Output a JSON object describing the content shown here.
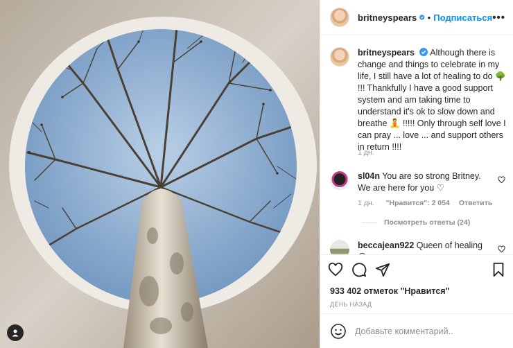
{
  "colors": {
    "accent": "#0095f6",
    "text": "#262626",
    "muted": "#8e8e8e",
    "divider": "#efefef"
  },
  "header": {
    "username": "britneyspears",
    "separator": "•",
    "follow_label": "Подписаться",
    "more_icon": "more-options-icon",
    "more_label": "•••"
  },
  "caption": {
    "username": "britneyspears",
    "text_part1": "Although there is change and things to celebrate in my life, I still have a lot of healing to do ",
    "emoji1": "🌳",
    "text_part2": " !!! Thankfully I have a good support system and am taking time to understand it's ok to slow down and breathe ",
    "emoji2": "🧘",
    "text_part3": " !!!!! Only through self love I can pray ... love ... and support others in return !!!!",
    "time": "1 дн."
  },
  "comments": [
    {
      "username": "sl04n",
      "text": "You are so strong Britney. We are here for you ♡",
      "time": "1 дн.",
      "likes": "\"Нравится\": 2 054",
      "reply_label": "Ответить",
      "view_replies": "Посмотреть ответы (24)"
    },
    {
      "username": "beccajean922",
      "text": "Queen of healing 😢"
    }
  ],
  "actions": {
    "like_icon": "heart-icon",
    "comment_icon": "comment-icon",
    "share_icon": "share-icon",
    "save_icon": "bookmark-icon"
  },
  "likes_text": "933 402 отметок \"Нравится\"",
  "posted_text": "ДЕНЬ НАЗАД",
  "add_comment": {
    "placeholder": "Добавьте комментарий.."
  }
}
